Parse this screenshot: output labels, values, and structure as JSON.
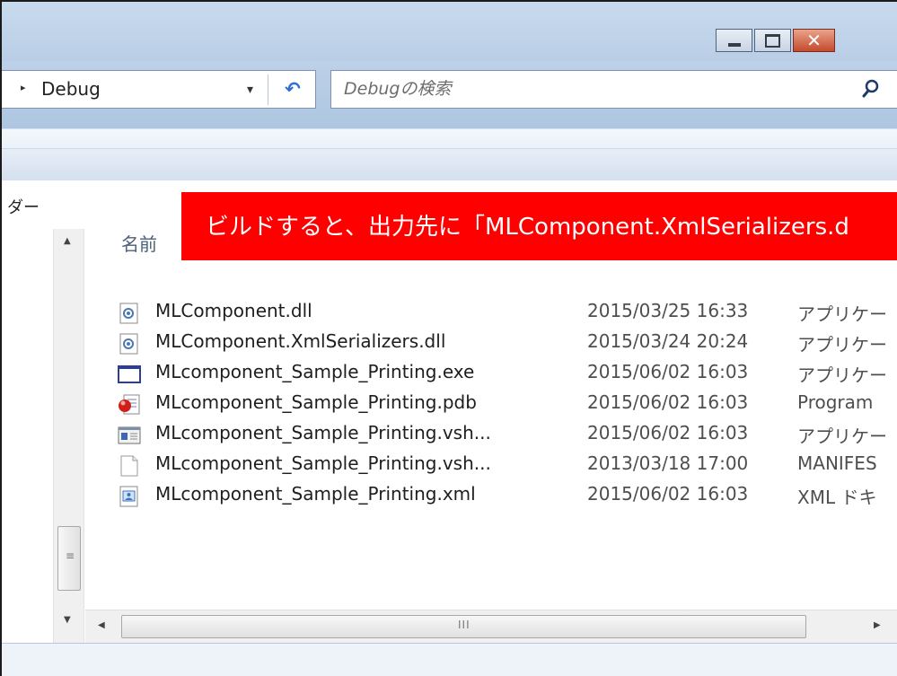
{
  "window": {
    "address": {
      "separator": "▸",
      "crumb": "Debug",
      "dropdown": "▾",
      "refresh": "↶"
    },
    "search": {
      "placeholder": "Debugの検索"
    }
  },
  "nav_pane": {
    "visible_label": "ダー"
  },
  "columns": {
    "name": "名前"
  },
  "files": [
    {
      "name": "MLComponent.dll",
      "date": "2015/03/25 16:33",
      "type": "アプリケー",
      "icon": "dll-icon"
    },
    {
      "name": "MLComponent.XmlSerializers.dll",
      "date": "2015/03/24 20:24",
      "type": "アプリケー",
      "icon": "dll-icon"
    },
    {
      "name": "MLcomponent_Sample_Printing.exe",
      "date": "2015/06/02 16:03",
      "type": "アプリケー",
      "icon": "exe-icon"
    },
    {
      "name": "MLcomponent_Sample_Printing.pdb",
      "date": "2015/06/02 16:03",
      "type": "Program",
      "icon": "pdb-icon"
    },
    {
      "name": "MLcomponent_Sample_Printing.vsh...",
      "date": "2015/06/02 16:03",
      "type": "アプリケー",
      "icon": "vshost-exe-icon"
    },
    {
      "name": "MLcomponent_Sample_Printing.vsh...",
      "date": "2013/03/18 17:00",
      "type": "MANIFES",
      "icon": "blank-file-icon"
    },
    {
      "name": "MLcomponent_Sample_Printing.xml",
      "date": "2015/06/02 16:03",
      "type": "XML ドキ",
      "icon": "xml-icon"
    }
  ],
  "scrollbar": {
    "grip_v": "≡",
    "grip_h": "III",
    "up": "▲",
    "down": "▼",
    "left": "◀",
    "right": "▶"
  },
  "annotation": {
    "text": "ビルドすると、出力先に「MLComponent.XmlSerializers.d",
    "color": "#ff0000"
  }
}
